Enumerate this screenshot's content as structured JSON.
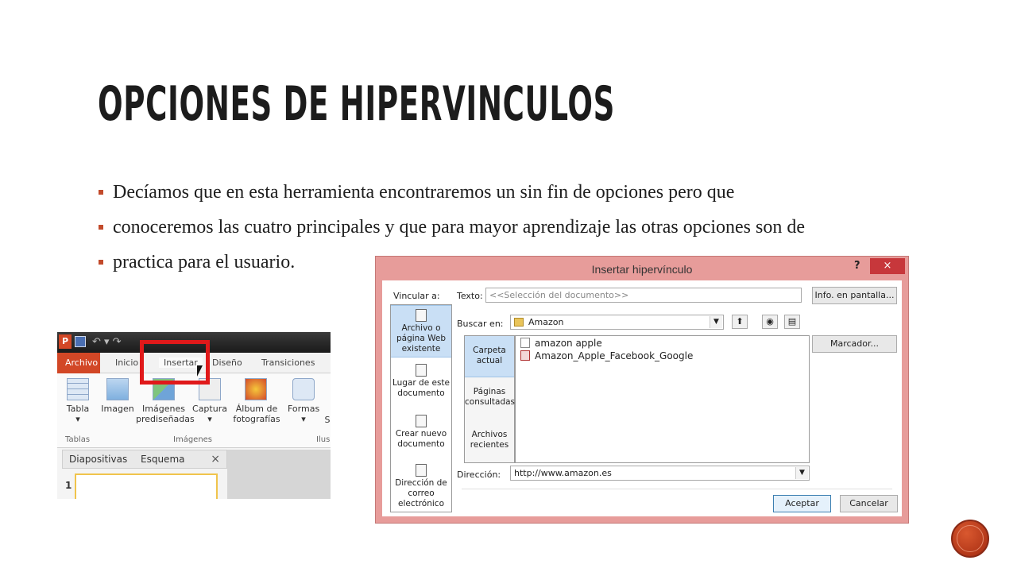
{
  "slide": {
    "title": "OPCIONES DE HIPERVINCULOS",
    "bullets": [
      "Decíamos que en esta herramienta encontraremos un sin fin de opciones pero que",
      "conoceremos las cuatro principales y que para mayor aprendizaje las otras opciones son de",
      "practica para el usuario."
    ]
  },
  "ribbon": {
    "app_icon": "P",
    "tabs": {
      "archivo": "Archivo",
      "inicio": "Inicio",
      "insertar": "Insertar",
      "diseno": "Diseño",
      "transiciones": "Transiciones"
    },
    "items": {
      "tabla": "Tabla",
      "imagen": "Imagen",
      "imagenes_pred": "Imágenes prediseñadas",
      "captura": "Captura",
      "album": "Álbum de fotografías",
      "formas": "Formas",
      "s": "S"
    },
    "groups": {
      "tablas": "Tablas",
      "imagenes": "Imágenes",
      "ilus": "Ilus"
    },
    "panel_tabs": {
      "diapositivas": "Diapositivas",
      "esquema": "Esquema",
      "close": "×"
    },
    "slide_number": "1"
  },
  "dialog": {
    "title": "Insertar hipervínculo",
    "help": "?",
    "close": "×",
    "vincular_label": "Vincular a:",
    "texto_label": "Texto:",
    "texto_value": "<<Selección del documento>>",
    "info_button": "Info. en pantalla...",
    "buscar_label": "Buscar en:",
    "buscar_value": "Amazon",
    "marcador_button": "Marcador...",
    "link_options": [
      "Archivo o página Web existente",
      "Lugar de este documento",
      "Crear nuevo documento",
      "Dirección de correo electrónico"
    ],
    "nav_options": [
      "Carpeta actual",
      "Páginas consultadas",
      "Archivos recientes"
    ],
    "files": [
      "amazon apple",
      "Amazon_Apple_Facebook_Google"
    ],
    "direccion_label": "Dirección:",
    "direccion_value": "http://www.amazon.es",
    "accept": "Aceptar",
    "cancel": "Cancelar"
  },
  "colors": {
    "accent": "#c24a2b",
    "dialog_border": "#e79c9a",
    "close_red": "#c7373b",
    "highlight_box": "#e0191a"
  }
}
